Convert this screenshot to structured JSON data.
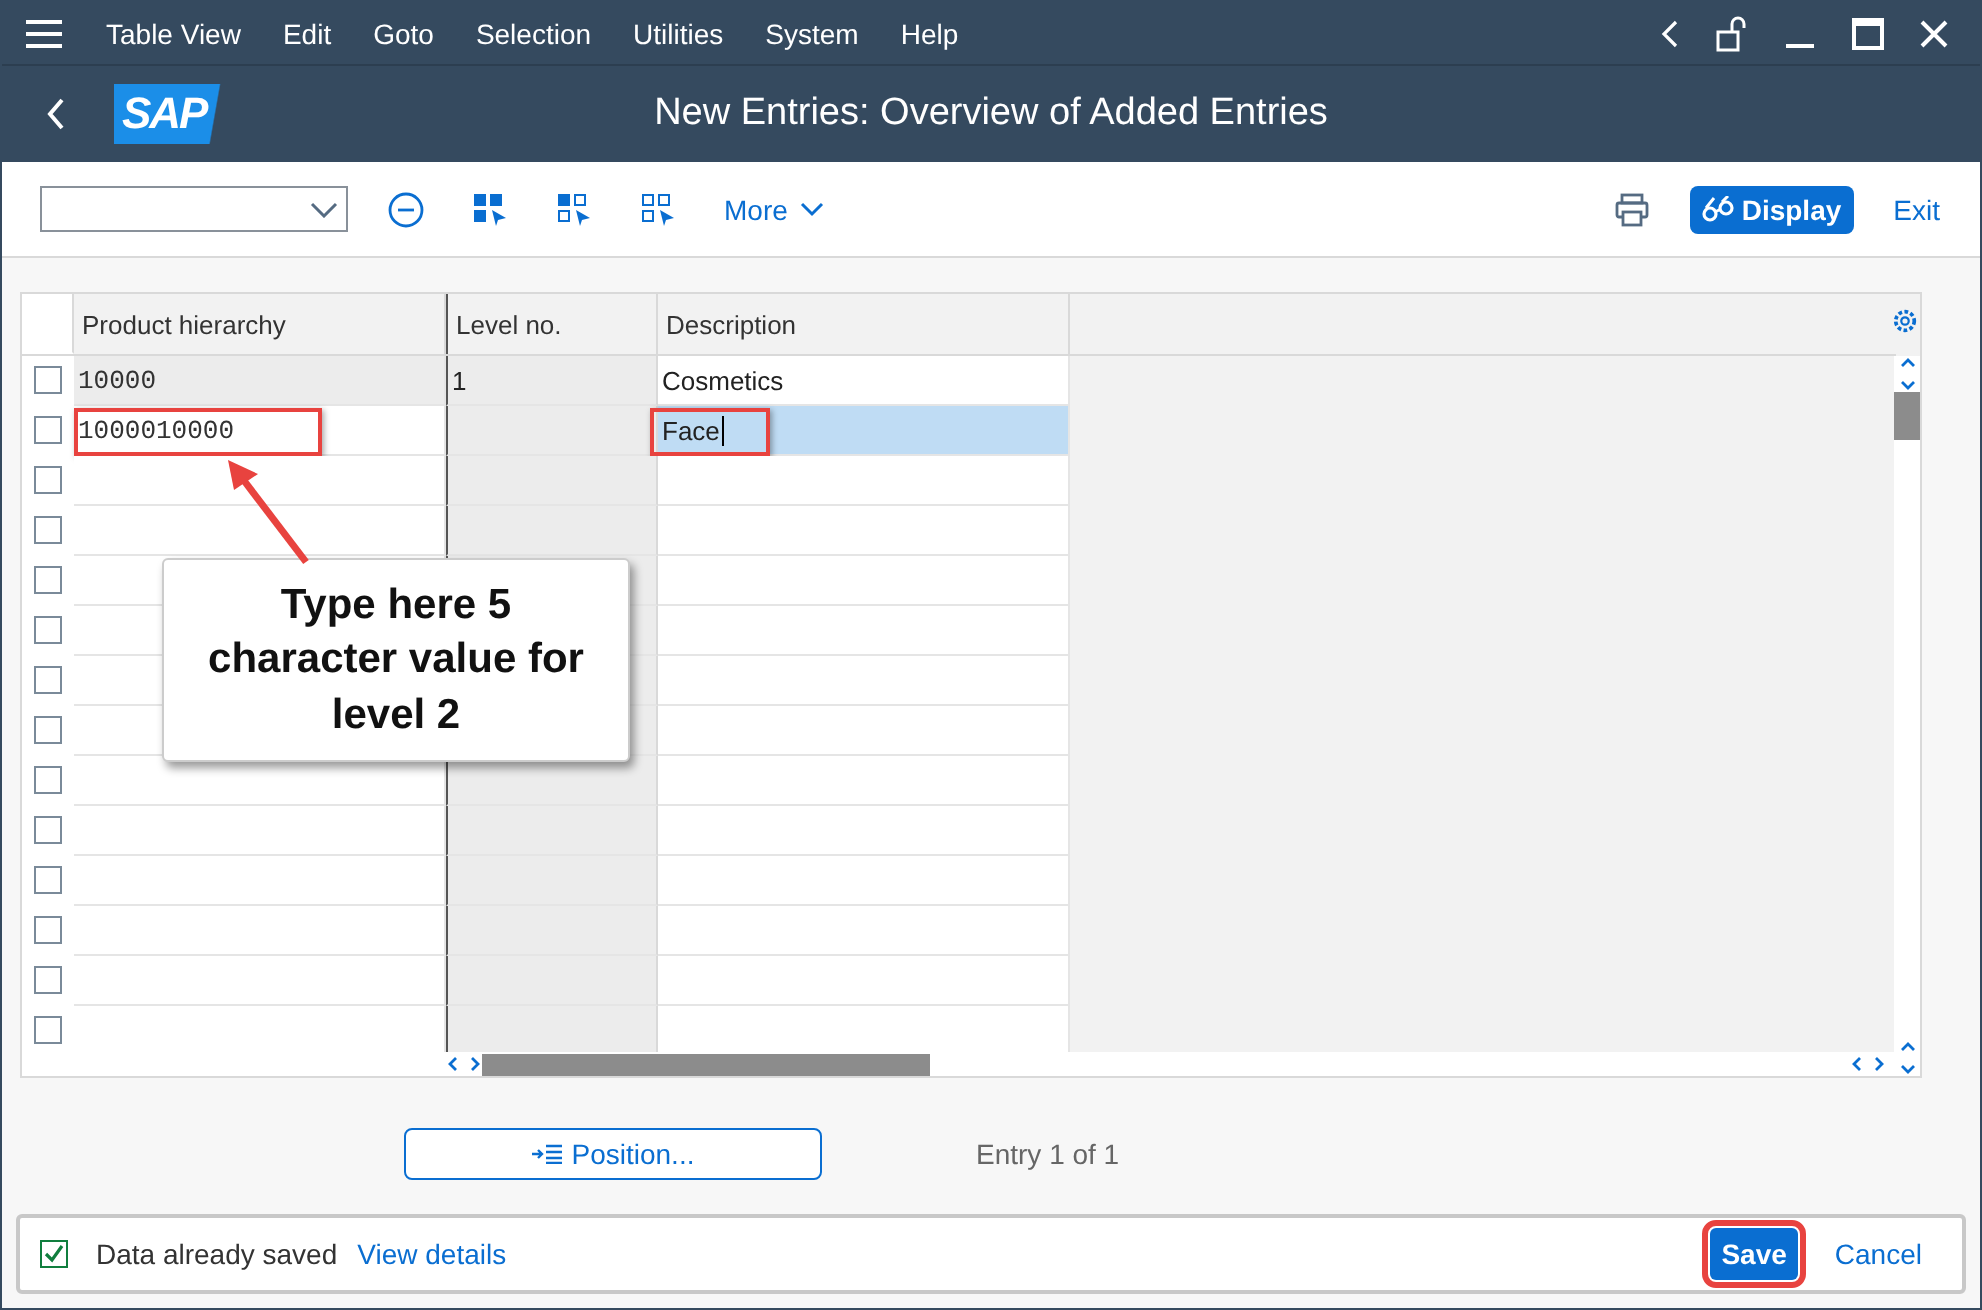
{
  "menu_bar": {
    "items": [
      "Table View",
      "Edit",
      "Goto",
      "Selection",
      "Utilities",
      "System",
      "Help"
    ]
  },
  "header": {
    "logo": "SAP",
    "title": "New Entries: Overview of Added Entries"
  },
  "toolbar": {
    "more": "More",
    "display": "Display",
    "exit": "Exit"
  },
  "table": {
    "columns": [
      "Product hierarchy",
      "Level no.",
      "Description"
    ],
    "rows": [
      {
        "checked": false,
        "key_locked": true,
        "focused": false,
        "marked": false,
        "cells": [
          "10000",
          "1",
          "Cosmetics"
        ]
      },
      {
        "checked": false,
        "key_locked": false,
        "focused": true,
        "marked": true,
        "cells": [
          "1000010000",
          null,
          "Face"
        ]
      },
      {
        "checked": false,
        "key_locked": false,
        "focused": false,
        "marked": false,
        "cells": []
      },
      {
        "checked": false,
        "key_locked": false,
        "focused": false,
        "marked": false,
        "cells": []
      },
      {
        "checked": false,
        "key_locked": false,
        "focused": false,
        "marked": false,
        "cells": []
      },
      {
        "checked": false,
        "key_locked": false,
        "focused": false,
        "marked": false,
        "cells": []
      },
      {
        "checked": false,
        "key_locked": false,
        "focused": false,
        "marked": false,
        "cells": []
      },
      {
        "checked": false,
        "key_locked": false,
        "focused": false,
        "marked": false,
        "cells": []
      },
      {
        "checked": false,
        "key_locked": false,
        "focused": false,
        "marked": false,
        "cells": []
      },
      {
        "checked": false,
        "key_locked": false,
        "focused": false,
        "marked": false,
        "cells": []
      },
      {
        "checked": false,
        "key_locked": false,
        "focused": false,
        "marked": false,
        "cells": []
      },
      {
        "checked": false,
        "key_locked": false,
        "focused": false,
        "marked": false,
        "cells": []
      },
      {
        "checked": false,
        "key_locked": false,
        "focused": false,
        "marked": false,
        "cells": []
      },
      {
        "checked": false,
        "key_locked": false,
        "focused": false,
        "marked": false,
        "cells": []
      }
    ]
  },
  "callout": {
    "text": "Type here 5 character value for level 2"
  },
  "position_button": "Position...",
  "entry_count": "Entry 1 of 1",
  "status": {
    "checked": true,
    "message": "Data already saved",
    "link": "View details"
  },
  "footer_buttons": [
    {
      "label": "Save",
      "kind": "primary",
      "highlighted": true
    },
    {
      "label": "Cancel",
      "kind": "plain",
      "highlighted": false
    }
  ]
}
